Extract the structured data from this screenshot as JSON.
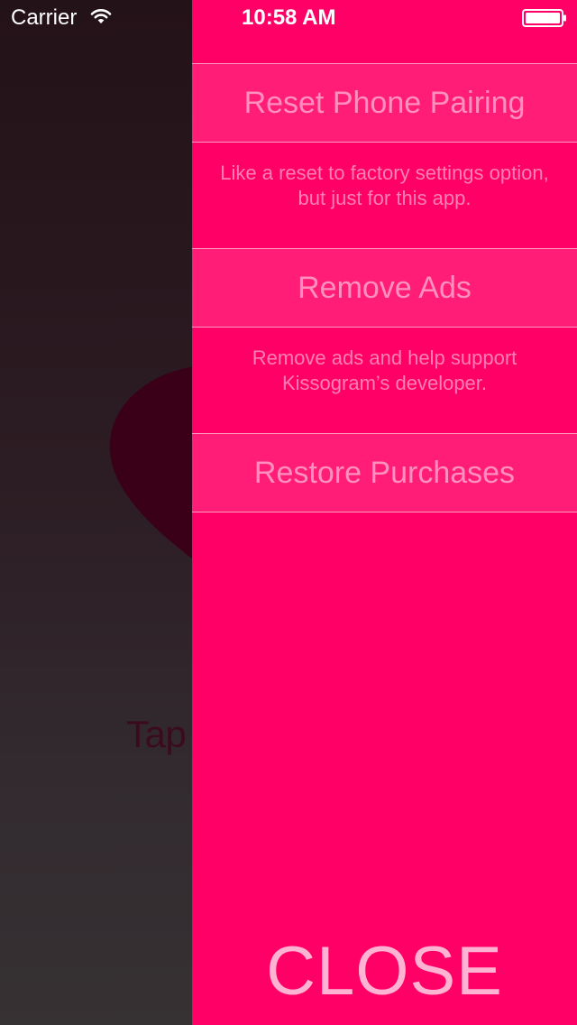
{
  "status_bar": {
    "carrier": "Carrier",
    "time": "10:58 AM",
    "wifi_icon": "wifi-icon",
    "battery_icon": "battery-icon"
  },
  "background_app": {
    "heart_icon": "heart-icon",
    "tap_label": "Tap"
  },
  "menu": {
    "items": [
      {
        "label": "Reset Phone Pairing",
        "description": "Like a reset to factory settings option, but just for this app."
      },
      {
        "label": "Remove Ads",
        "description": "Remove ads and help support Kissogram’s developer."
      },
      {
        "label": "Restore Purchases"
      }
    ],
    "close_label": "CLOSE"
  },
  "colors": {
    "menu_background": "#ff0066",
    "menu_button_background": "#ff1d77",
    "menu_button_text": "#ff8fbd",
    "close_text": "#ffb3d2",
    "background_panel_top": "#231217",
    "background_panel_bottom": "#363133",
    "heart": "#3a0018"
  }
}
